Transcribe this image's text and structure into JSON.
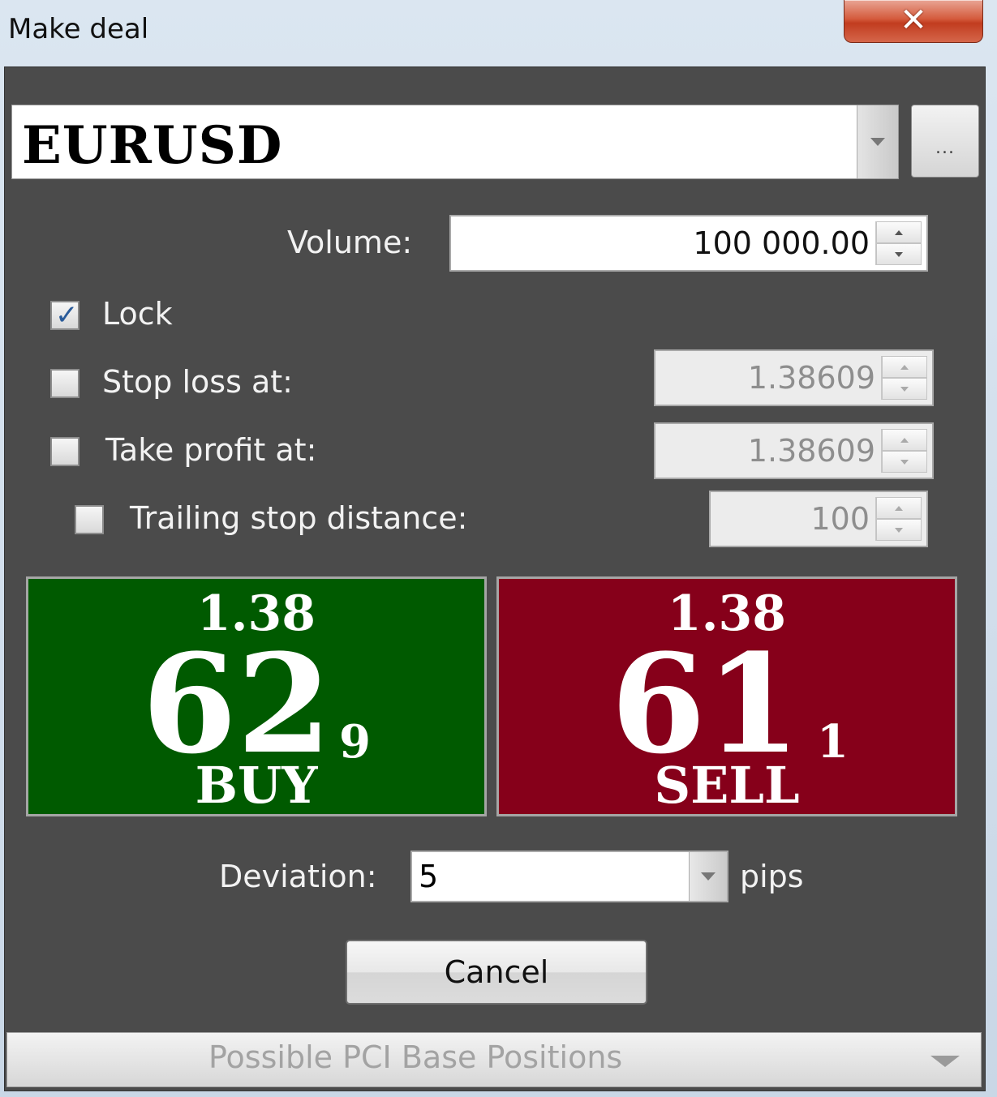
{
  "window": {
    "title": "Make deal",
    "close_glyph": "✕"
  },
  "symbol": {
    "value": "EURUSD",
    "more_label": "..."
  },
  "volume": {
    "label": "Volume:",
    "value": "100 000.00"
  },
  "lock": {
    "label": "Lock",
    "checked": true
  },
  "stop_loss": {
    "label": "Stop loss at:",
    "value": "1.38609",
    "checked": false
  },
  "take_profit": {
    "label": "Take profit at:",
    "value": "1.38609",
    "checked": false
  },
  "trailing_stop": {
    "label": "Trailing stop distance:",
    "value": "100",
    "checked": false
  },
  "buy": {
    "big_figure": "1.38",
    "pips": "62",
    "fraction": "9",
    "label": "BUY",
    "color": "#005a00"
  },
  "sell": {
    "big_figure": "1.38",
    "pips": "61",
    "fraction": "1",
    "label": "SELL",
    "color": "#86001a"
  },
  "deviation": {
    "label": "Deviation:",
    "value": "5",
    "unit": "pips"
  },
  "cancel_label": "Cancel",
  "expander_label": "Possible PCI Base Positions"
}
